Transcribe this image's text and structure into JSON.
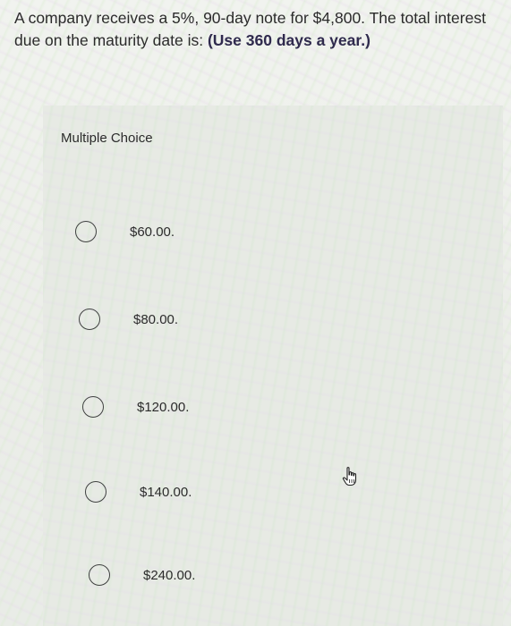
{
  "question": {
    "text_plain": "A company receives a 5%, 90-day note for $4,800. The total interest due on the maturity date is: ",
    "emphasis": "(Use 360 days a year.)"
  },
  "section_title": "Multiple Choice",
  "choices": [
    {
      "label": "$60.00."
    },
    {
      "label": "$80.00."
    },
    {
      "label": "$120.00."
    },
    {
      "label": "$140.00."
    },
    {
      "label": "$240.00."
    }
  ],
  "icons": {
    "cursor": "hand-pointer-icon",
    "radio": "radio-unselected-icon"
  },
  "colors": {
    "emphasis_text": "#2f2a4d",
    "body_text": "#2b2b2b"
  }
}
